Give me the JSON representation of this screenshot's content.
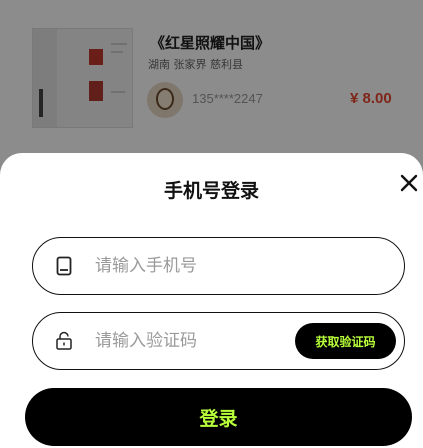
{
  "product": {
    "title": "《红星照耀中国》",
    "location": "湖南 张家界 慈利县",
    "seller_phone": "135****2247",
    "price": "¥ 8.00"
  },
  "login_sheet": {
    "title": "手机号登录",
    "phone_placeholder": "请输入手机号",
    "code_placeholder": "请输入验证码",
    "get_code_label": "获取验证码",
    "login_label": "登录",
    "close_icon": "close-icon",
    "phone_icon": "phone-icon",
    "lock_icon": "lock-icon"
  },
  "colors": {
    "accent": "#b8ff3a",
    "button_bg": "#000000",
    "price": "#e8452f"
  }
}
